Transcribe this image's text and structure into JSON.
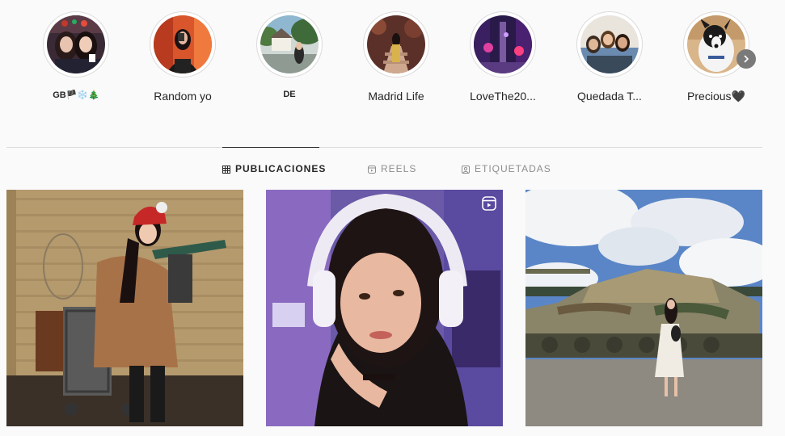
{
  "highlights": [
    {
      "label": "GB🏴❄️🎄"
    },
    {
      "label": "Random yo"
    },
    {
      "label": "DE"
    },
    {
      "label": "Madrid Life"
    },
    {
      "label": "LoveThe20..."
    },
    {
      "label": "Quedada T..."
    },
    {
      "label": "Precious🖤"
    }
  ],
  "highlights_next_icon": "chevron-right-icon",
  "tabs": [
    {
      "label": "PUBLICACIONES",
      "icon": "grid-icon",
      "active": true
    },
    {
      "label": "REELS",
      "icon": "reels-icon",
      "active": false
    },
    {
      "label": "ETIQUETADAS",
      "icon": "tagged-icon",
      "active": false
    }
  ],
  "posts": [
    {
      "type": "photo"
    },
    {
      "type": "reel",
      "badge_icon": "reels-badge-icon"
    },
    {
      "type": "photo"
    }
  ]
}
